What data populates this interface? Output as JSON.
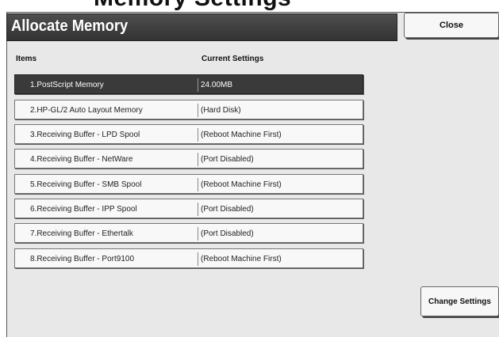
{
  "window": {
    "top_banner_text": "Memory Settings",
    "title": "Allocate Memory",
    "close_label": "Close"
  },
  "table": {
    "headers": {
      "items": "Items",
      "settings": "Current Settings"
    },
    "rows": [
      {
        "item": "1.PostScript Memory",
        "value": "24.00MB",
        "selected": true
      },
      {
        "item": "2.HP-GL/2 Auto Layout Memory",
        "value": "(Hard Disk)",
        "selected": false
      },
      {
        "item": "3.Receiving Buffer - LPD Spool",
        "value": "(Reboot Machine First)",
        "selected": false
      },
      {
        "item": "4.Receiving Buffer - NetWare",
        "value": "(Port Disabled)",
        "selected": false
      },
      {
        "item": "5.Receiving Buffer - SMB Spool",
        "value": "(Reboot Machine First)",
        "selected": false
      },
      {
        "item": "6.Receiving Buffer - IPP Spool",
        "value": "(Port Disabled)",
        "selected": false
      },
      {
        "item": "7.Receiving Buffer - Ethertalk",
        "value": "(Port Disabled)",
        "selected": false
      },
      {
        "item": "8.Receiving Buffer - Port9100",
        "value": "(Reboot Machine First)",
        "selected": false
      }
    ]
  },
  "actions": {
    "change_settings_label": "Change Settings"
  },
  "colors": {
    "title_bar": "#3a3a3a",
    "selected_row": "#3a3a3a",
    "panel_bg": "#e8e8e8"
  }
}
